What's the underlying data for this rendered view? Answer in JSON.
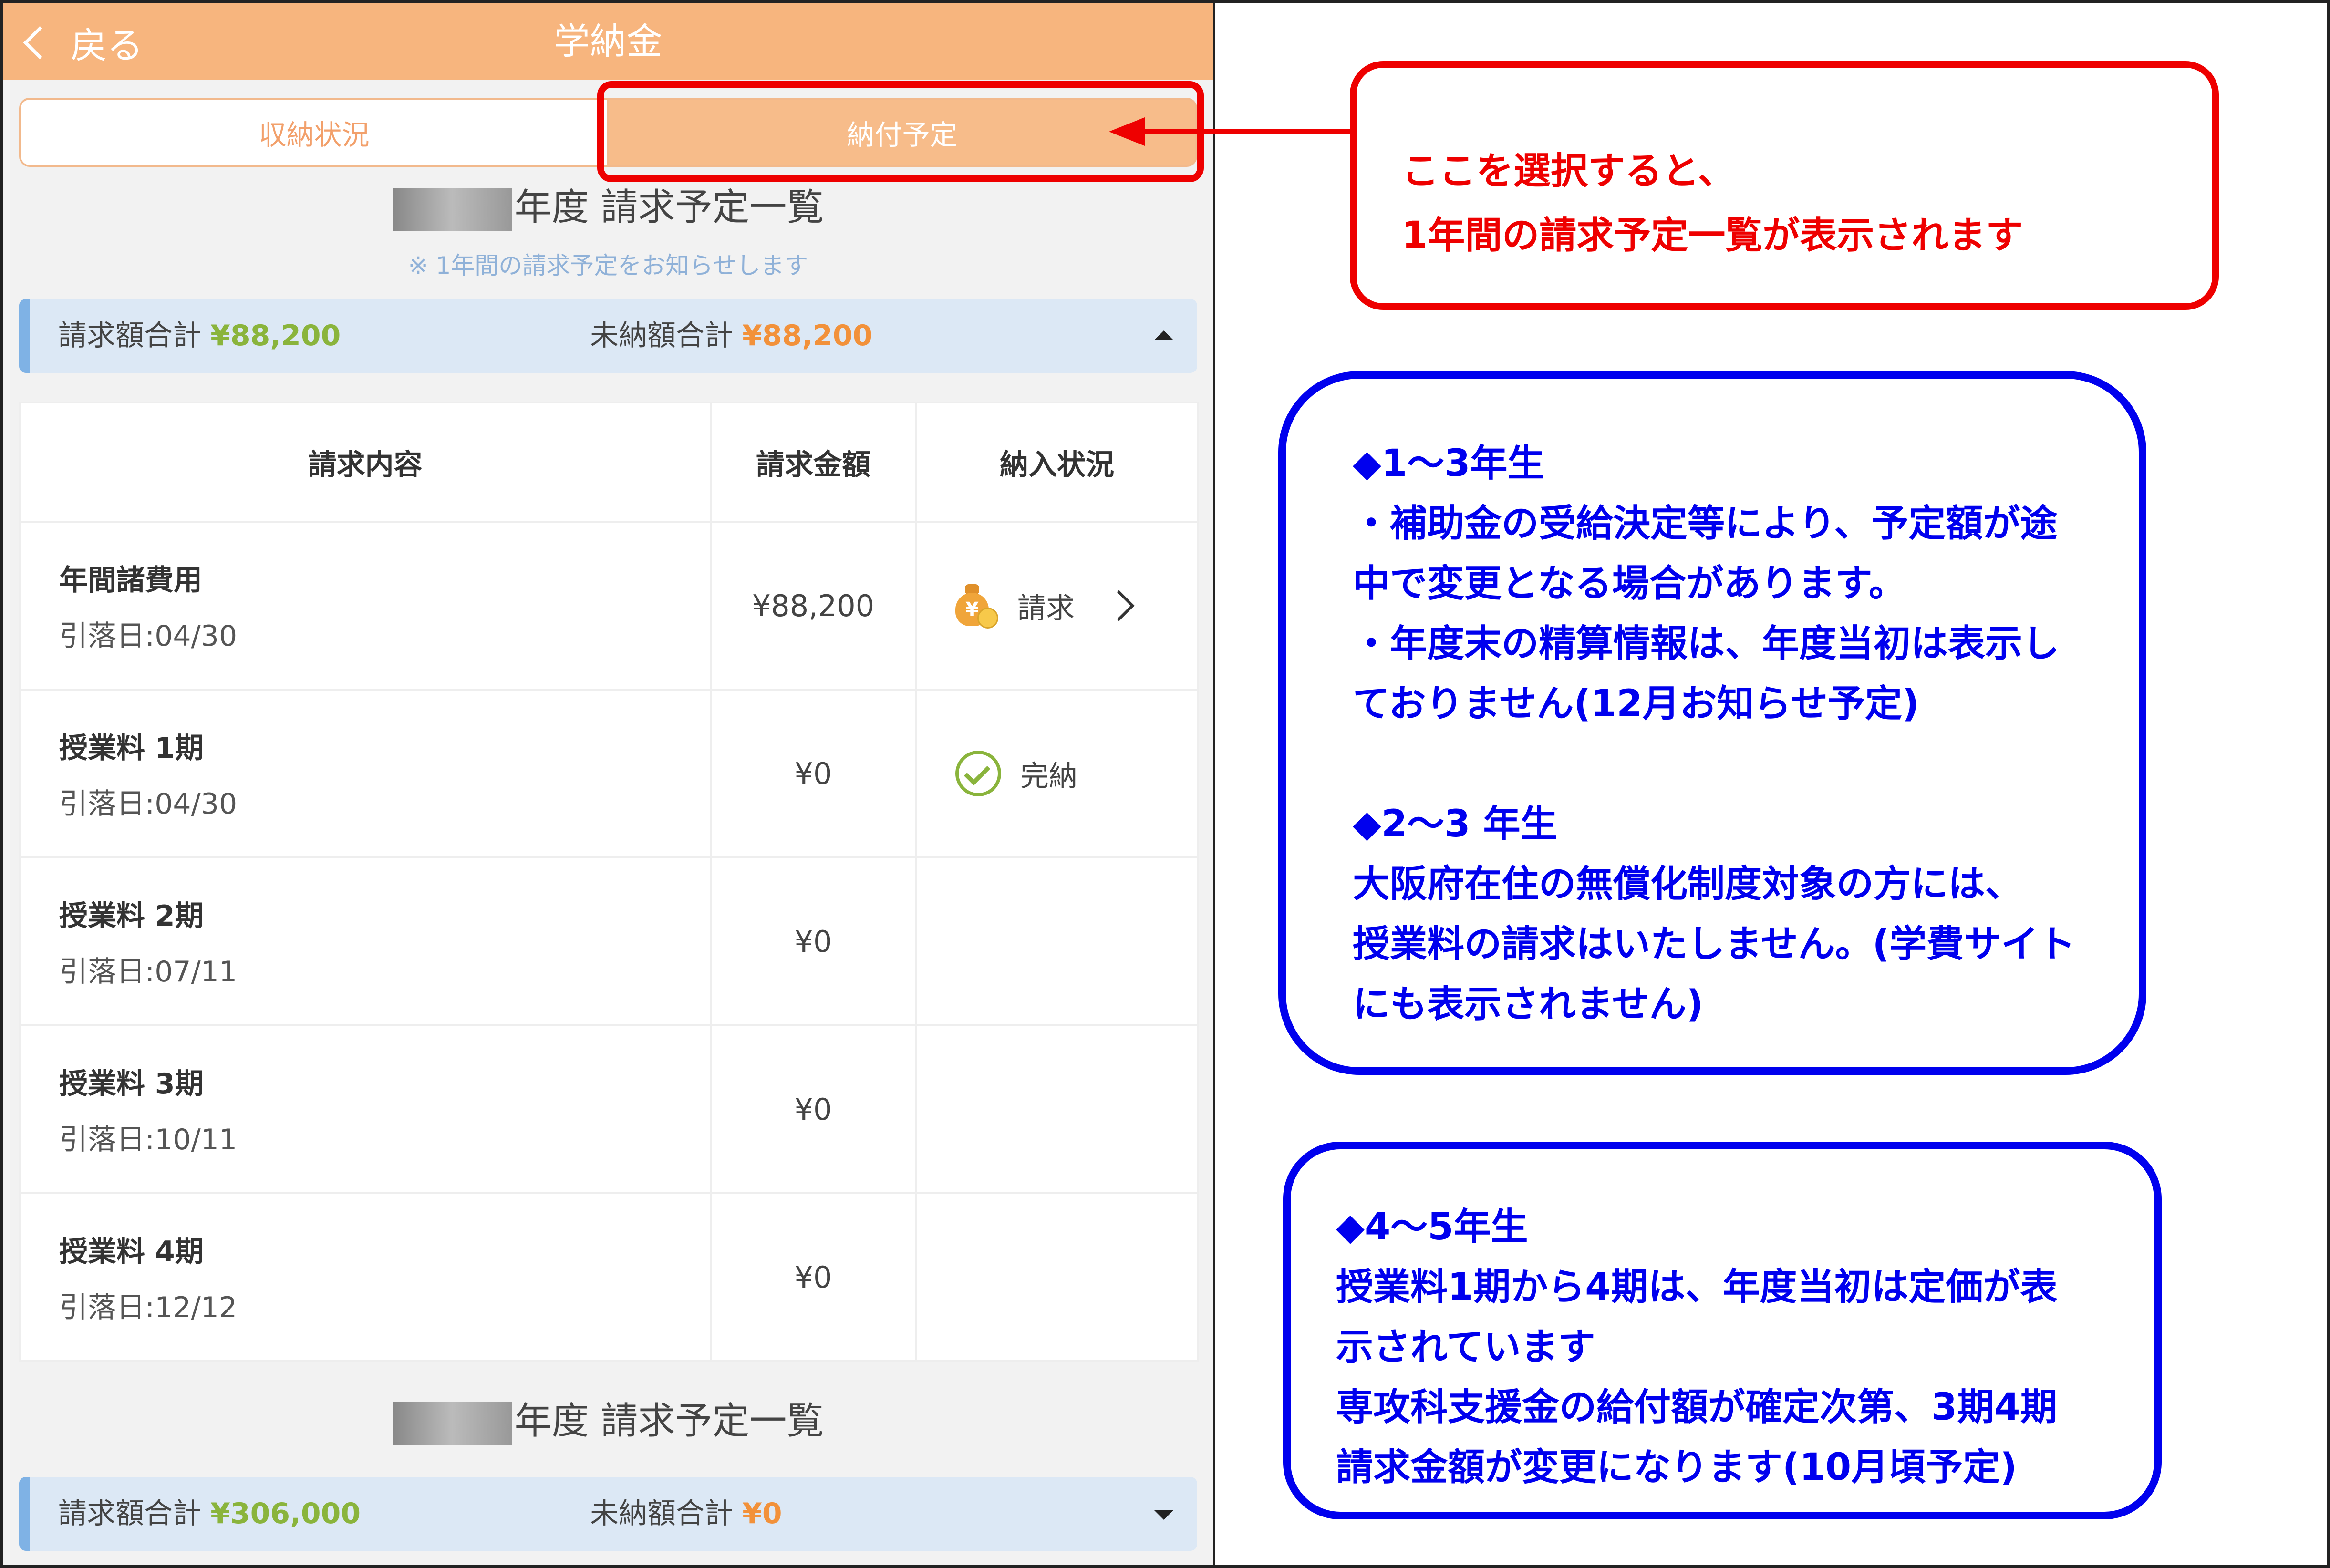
{
  "header": {
    "back_label": "戻る",
    "title": "学納金"
  },
  "tabs": [
    {
      "label": "収納状況",
      "active": false
    },
    {
      "label": "納付予定",
      "active": true
    }
  ],
  "section1": {
    "title_suffix": "年度 請求予定一覧",
    "note": "※ 1年間の請求予定をお知らせします",
    "summary": {
      "billed_label": "請求額合計",
      "billed_value": "¥88,200",
      "unpaid_label": "未納額合計",
      "unpaid_value": "¥88,200"
    }
  },
  "table": {
    "headers": [
      "請求内容",
      "請求金額",
      "納入状況"
    ],
    "rows": [
      {
        "name": "年間諸費用",
        "date": "引落日:04/30",
        "amount": "¥88,200",
        "status": "請求",
        "status_icon": "money-bag-icon"
      },
      {
        "name": "授業料 1期",
        "date": "引落日:04/30",
        "amount": "¥0",
        "status": "完納",
        "status_icon": "check-circle-icon"
      },
      {
        "name": "授業料 2期",
        "date": "引落日:07/11",
        "amount": "¥0",
        "status": ""
      },
      {
        "name": "授業料 3期",
        "date": "引落日:10/11",
        "amount": "¥0",
        "status": ""
      },
      {
        "name": "授業料 4期",
        "date": "引落日:12/12",
        "amount": "¥0",
        "status": ""
      }
    ]
  },
  "section2": {
    "title_suffix": "年度 請求予定一覧",
    "summary": {
      "billed_label": "請求額合計",
      "billed_value": "¥306,000",
      "unpaid_label": "未納額合計",
      "unpaid_value": "¥0"
    }
  },
  "callouts": {
    "red": [
      "ここを選択すると、",
      "1年間の請求予定一覧が表示されます"
    ],
    "blue1": {
      "heading1": "◆1～3年生",
      "lines1": [
        "・補助金の受給決定等により、予定額が途",
        "中で変更となる場合があります。",
        "・年度末の精算情報は、年度当初は表示し",
        "ておりません(12月お知らせ予定)"
      ],
      "heading2": "◆2～3 年生",
      "lines2": [
        "大阪府在住の無償化制度対象の方には、",
        "授業料の請求はいたしません。(学費サイト",
        "にも表示されません)"
      ]
    },
    "blue2": {
      "heading": "◆4～5年生",
      "lines": [
        "授業料1期から4期は、年度当初は定価が表",
        "示されています",
        "専攻科支援金の給付額が確定次第、3期4期",
        "請求金額が変更になります(10月頃予定)"
      ]
    }
  },
  "colors": {
    "header": "#f7b57e",
    "accent_green": "#8ab43c",
    "accent_orange": "#f2913a",
    "annotation_red": "#ee0000",
    "annotation_blue": "#0000ee"
  }
}
